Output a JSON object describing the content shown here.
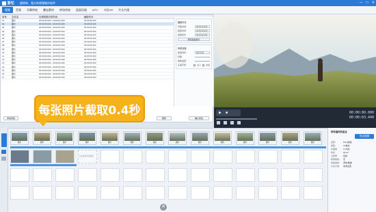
{
  "window": {
    "app_name": "影忆",
    "title": "超简单、强大的视频制作软件",
    "controls": [
      "—",
      "□",
      "✕"
    ]
  },
  "menu": [
    "视频",
    "音频",
    "字幕特效",
    "叠加素材",
    "转场特效",
    "画面风格",
    "MTV",
    "卡拉OK",
    "片头片尾"
  ],
  "table": {
    "headers": [
      "序号",
      "文件名",
      "在源视频中的时间",
      "截取时长"
    ],
    "rows": [
      {
        "no": "01",
        "name": "图片",
        "time": "00:00:00.000 - 00:00:00.200",
        "dur": "00:00:00.200"
      },
      {
        "no": "02",
        "name": "图片",
        "time": "00:00:00.000 - 00:00:00.400",
        "dur": "00:00:00.400"
      },
      {
        "no": "03",
        "name": "图片",
        "time": "00:00:00.000 - 00:00:00.400",
        "dur": "00:00:00.400"
      },
      {
        "no": "04",
        "name": "图片",
        "time": "00:00:00.000 - 00:00:00.400",
        "dur": "00:00:00.400"
      },
      {
        "no": "05",
        "name": "图片",
        "time": "00:00:00.000 - 00:00:00.400",
        "dur": "00:00:00.400"
      },
      {
        "no": "06",
        "name": "图片",
        "time": "00:00:00.000 - 00:00:00.400",
        "dur": "00:00:00.400"
      },
      {
        "no": "07",
        "name": "图片",
        "time": "00:00:00.000 - 00:00:00.400",
        "dur": "00:00:00.400"
      },
      {
        "no": "08",
        "name": "图片",
        "time": "00:00:00.000 - 00:00:00.400",
        "dur": "00:00:00.400"
      },
      {
        "no": "09",
        "name": "图片",
        "time": "00:00:00.000 - 00:00:00.400",
        "dur": "00:00:00.400"
      },
      {
        "no": "10",
        "name": "图片",
        "time": "00:00:00.000 - 00:00:00.400",
        "dur": "00:00:00.400"
      },
      {
        "no": "11",
        "name": "图片",
        "time": "00:00:00.000 - 00:00:00.400",
        "dur": "00:00:00.400"
      },
      {
        "no": "12",
        "name": "图片",
        "time": "00:00:00.000 - 00:00:00.400",
        "dur": "00:00:00.400"
      },
      {
        "no": "13",
        "name": "图片",
        "time": "00:00:00.000 - 00:00:00.400",
        "dur": "00:00:00.400"
      },
      {
        "no": "14",
        "name": "图片",
        "time": "00:00:00.000 - 00:00:00.400",
        "dur": "00:00:00.400"
      },
      {
        "no": "15",
        "name": "图片",
        "time": "00:00:00.000 - 00:00:00.400",
        "dur": "00:00:00.400"
      },
      {
        "no": "16",
        "name": "图片",
        "time": "00:00:00.000 - 00:00:00.400",
        "dur": "00:00:00.400"
      },
      {
        "no": "17",
        "name": "图片",
        "time": "00:00:00.000 - 00:00:00.400",
        "dur": "00:00:00.400"
      }
    ],
    "add_label": "添加视频",
    "delete_label": "删除",
    "confirm_label": "确认修改"
  },
  "settings": {
    "clip_title": "截取时长",
    "start_label": "开始时间:",
    "start_value": "00:00:00.000",
    "end_label": "结束时间:",
    "end_value": "00:00:00.400",
    "duration_label": "截取时长:",
    "duration_value": "00:00:00.400",
    "preview_button": "预览截取部分",
    "sound_title": "声音设置",
    "mode_label": "使用音乐:",
    "mode_value": "原片声音",
    "volume_label": "音量",
    "speed_label": "播放速度:",
    "fade_label": "头尾声音:",
    "fade_in": "淡入",
    "fade_out": "淡出"
  },
  "transport": {
    "time_current": "00:00:00.000",
    "time_total": "00:00:03.440"
  },
  "storyboard": {
    "thumb_caption": "图片",
    "placeholder": "双击此处添加视频",
    "thumb_count": 14
  },
  "right_panel": {
    "title": "所有插件的组合",
    "export_label": "导出视频",
    "rows": [
      {
        "k": "名称:",
        "v": "MTV视频"
      },
      {
        "k": "类型:",
        "v": "37素材"
      },
      {
        "k": "共截取:",
        "v": "17片段"
      },
      {
        "k": "时长:",
        "v": "00:03"
      },
      {
        "k": "分辨率:",
        "v": "自动"
      },
      {
        "k": "转场特效:",
        "v": "无"
      },
      {
        "k": "叠加素材:",
        "v": "添加/拖拽"
      },
      {
        "k": "片头片尾:",
        "v": "尚未设置"
      }
    ]
  },
  "callout": {
    "text": "每张照片截取0.4秒"
  },
  "colors": {
    "accent": "#2b7ad6",
    "callout": "#f6b21b",
    "selection": "#cfe3fb"
  }
}
